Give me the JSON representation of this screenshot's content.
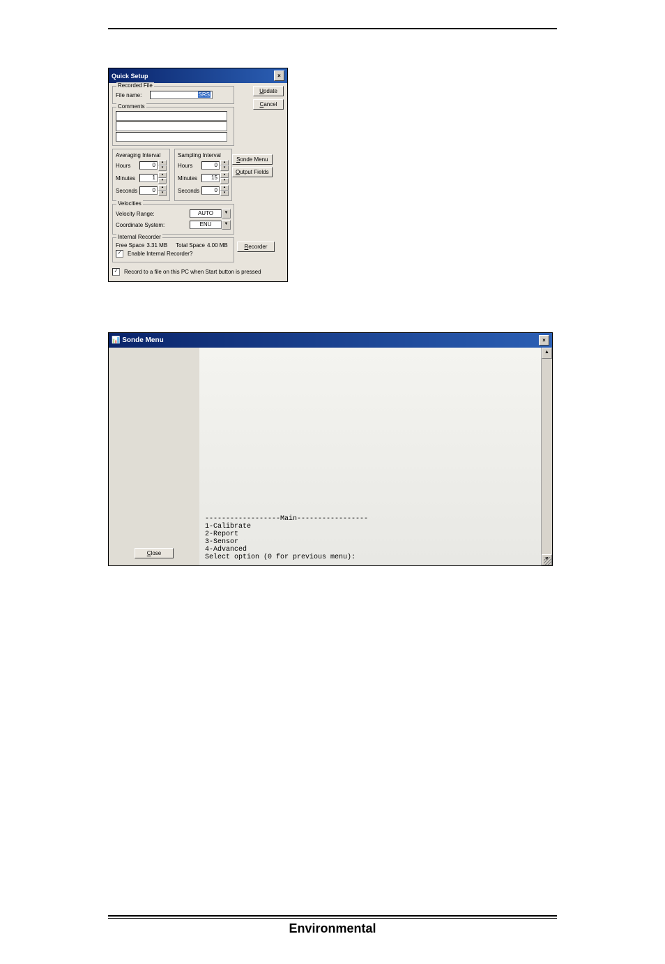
{
  "quick_setup": {
    "title": "Quick Setup",
    "recorded_file": {
      "legend": "Recorded File",
      "filename_label": "File name:",
      "filename_value": "SRS"
    },
    "comments": {
      "legend": "Comments"
    },
    "avg_interval": {
      "legend": "Averaging Interval",
      "hours_label": "Hours",
      "hours_value": "0",
      "minutes_label": "Minutes",
      "minutes_value": "1",
      "seconds_label": "Seconds",
      "seconds_value": "0"
    },
    "samp_interval": {
      "legend": "Sampling Interval",
      "hours_label": "Hours",
      "hours_value": "0",
      "minutes_label": "Minutes",
      "minutes_value": "15",
      "seconds_label": "Seconds",
      "seconds_value": "0"
    },
    "velocities": {
      "legend": "Velocities",
      "range_label": "Velocity Range:",
      "range_value": "AUTO",
      "coord_label": "Coordinate System:",
      "coord_value": "ENU"
    },
    "internal_recorder": {
      "legend": "Internal Recorder",
      "free_label": "Free Space",
      "free_value": "3.31 MB",
      "total_label": "Total Space",
      "total_value": "4.00 MB",
      "enable_label": "Enable Internal Recorder?"
    },
    "record_pc_label": "Record to a file on this PC when Start button is pressed",
    "buttons": {
      "update": "Update",
      "cancel": "Cancel",
      "sonde_menu": "Sonde Menu",
      "output_fields": "Output Fields",
      "recorder": "Recorder"
    }
  },
  "sonde_menu": {
    "title": "Sonde Menu",
    "close": "Close",
    "terminal_header": "------------------Main-----------------",
    "menu_items": [
      "1-Calibrate",
      "2-Report",
      "3-Sensor",
      "4-Advanced"
    ],
    "prompt": "Select option (0 for previous menu):"
  },
  "footer": {
    "brand": "Environmental"
  }
}
